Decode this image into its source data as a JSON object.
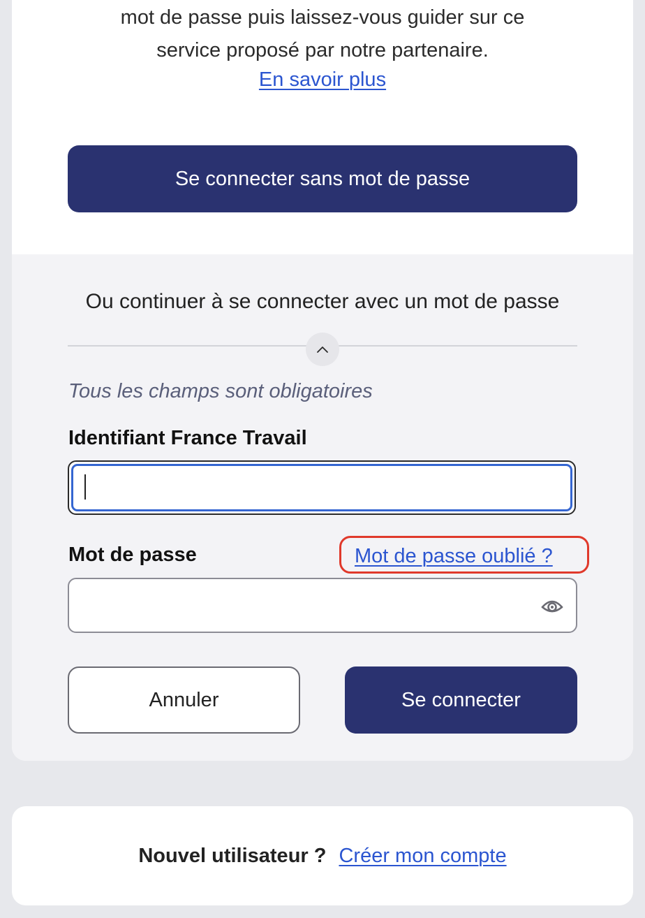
{
  "intro": {
    "line1": "mot de passe puis laissez-vous guider sur ce",
    "line2": "service proposé par notre partenaire.",
    "learn_more_link": "En savoir plus"
  },
  "passwordless_button": "Se connecter sans mot de passe",
  "password_section": {
    "heading": "Ou continuer à se connecter avec un mot de passe",
    "collapse_icon": "chevron-up-icon",
    "required_note": "Tous les champs sont obligatoires",
    "identifier": {
      "label": "Identifiant France Travail",
      "value": ""
    },
    "password": {
      "label": "Mot de passe",
      "value": "",
      "forgot_link": "Mot de passe oublié ?",
      "toggle_icon": "eye-icon"
    },
    "cancel_button": "Annuler",
    "connect_button": "Se connecter"
  },
  "signup": {
    "question": "Nouvel utilisateur ?",
    "link": "Créer mon compte"
  },
  "colors": {
    "primary": "#2a3270",
    "link": "#2b55d0",
    "focus": "#3566d1",
    "highlight": "#e0392b",
    "section_bg": "#f3f3f6",
    "page_bg": "#e7e8ec"
  }
}
